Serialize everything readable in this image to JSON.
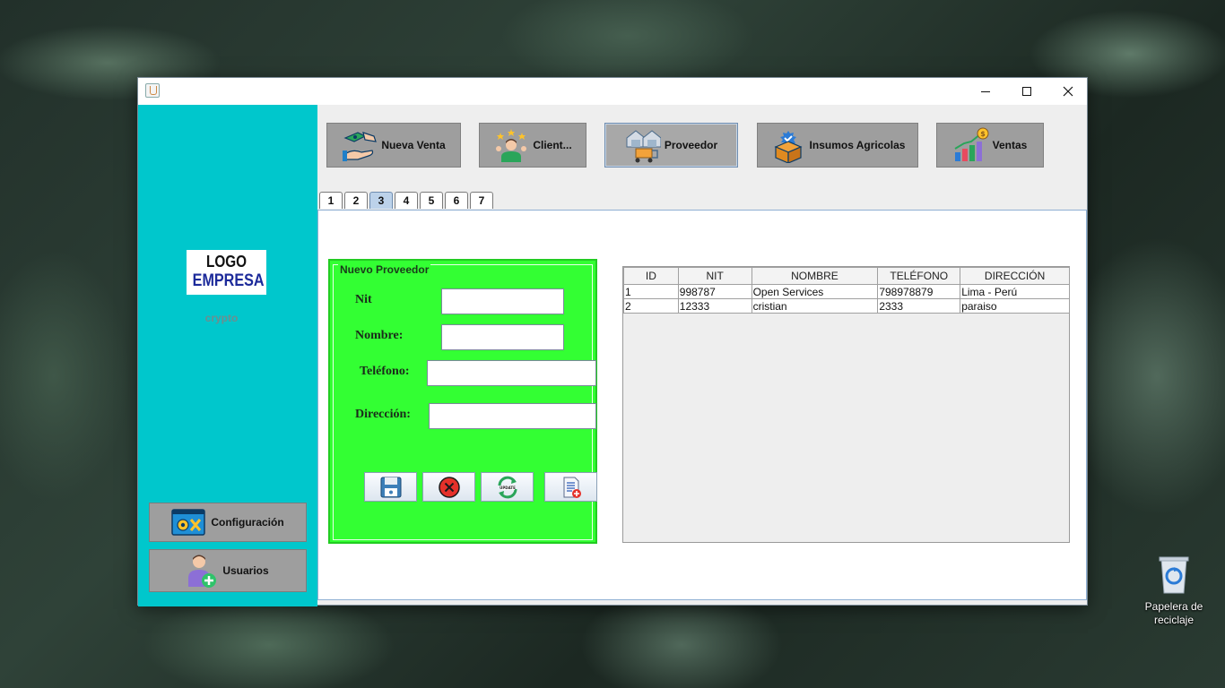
{
  "desktop": {
    "recycle_bin_label": "Papelera de reciclaje"
  },
  "toolbar": {
    "buttons": [
      {
        "label": "Nueva Venta",
        "icon": "money-handshake-icon"
      },
      {
        "label": "Client...",
        "icon": "customer-rating-icon"
      },
      {
        "label": "Proveedor",
        "icon": "supplier-warehouse-icon"
      },
      {
        "label": "Insumos Agricolas",
        "icon": "box-check-icon"
      },
      {
        "label": "Ventas",
        "icon": "sales-chart-icon"
      }
    ]
  },
  "tabs": [
    "1",
    "2",
    "3",
    "4",
    "5",
    "6",
    "7"
  ],
  "active_tab": "3",
  "sidebar": {
    "logo_line1": "LOGO",
    "logo_line2": "EMPRESA",
    "brand": "crypto",
    "config_label": "Configuración",
    "users_label": "Usuarios"
  },
  "form": {
    "legend": "Nuevo Proveedor",
    "nit_label": "Nit",
    "nombre_label": "Nombre:",
    "telefono_label": "Teléfono:",
    "direccion_label": "Dirección:",
    "nit_value": "",
    "nombre_value": "",
    "telefono_value": "",
    "direccion_value": ""
  },
  "table": {
    "headers": [
      "ID",
      "NIT",
      "NOMBRE",
      "TELÉFONO",
      "DIRECCIÓN"
    ],
    "rows": [
      [
        "1",
        "998787",
        "Open Services",
        "798978879",
        "Lima - Perú"
      ],
      [
        "2",
        "12333",
        "cristian",
        "2333",
        "paraiso"
      ]
    ]
  },
  "colors": {
    "sidebar": "#00c7cc",
    "form_panel": "#33ff33",
    "button_gray": "#9e9e9e"
  }
}
